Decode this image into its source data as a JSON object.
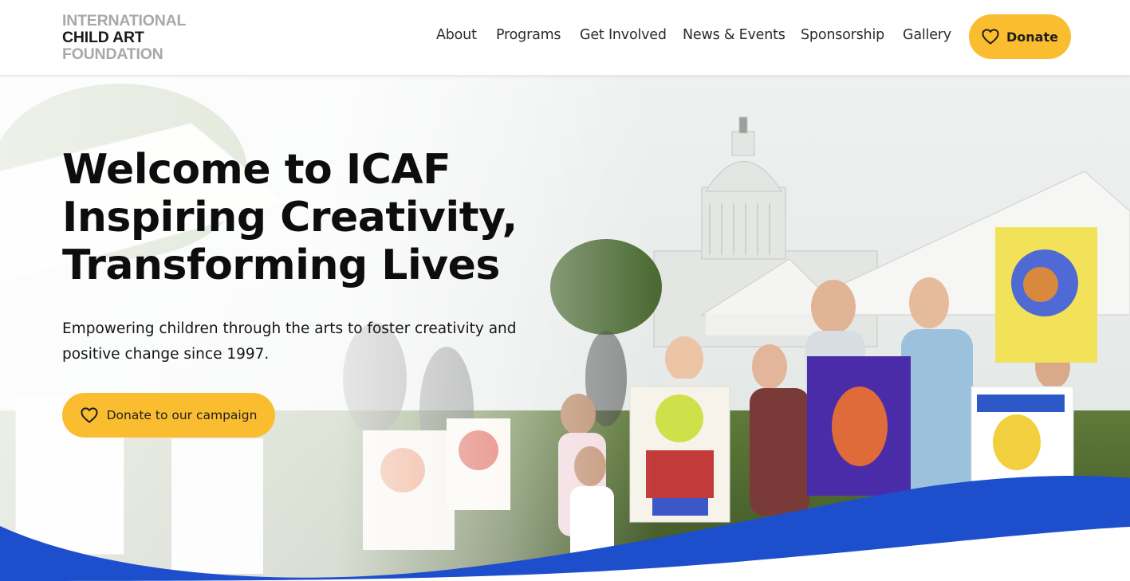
{
  "brand": {
    "line1": "INTERNATIONAL",
    "line2": "CHILD ART",
    "line3": "FOUNDATION"
  },
  "nav": {
    "items": [
      {
        "label": "About"
      },
      {
        "label": "Programs"
      },
      {
        "label": "Get Involved"
      },
      {
        "label": "News & Events"
      },
      {
        "label": "Sponsorship"
      },
      {
        "label": "Gallery"
      }
    ],
    "donate_label": "Donate",
    "donate_icon": "heart-icon"
  },
  "hero": {
    "title_lines": [
      "Welcome to ICAF",
      "Inspiring Creativity,",
      "Transforming Lives"
    ],
    "subtitle": "Empowering children through the arts to foster creativity and positive change since 1997.",
    "cta_label": "Donate to our campaign",
    "cta_icon": "heart-icon"
  },
  "colors": {
    "accent_yellow": "#fbbd30",
    "wave_blue": "#1d4fcc",
    "text_dark": "#0d0d0d"
  }
}
